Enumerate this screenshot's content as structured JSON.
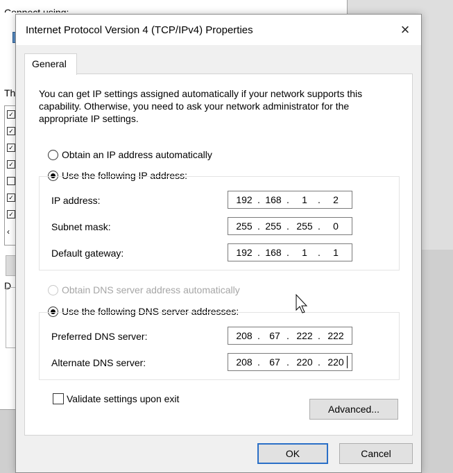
{
  "background": {
    "connect_using_partial": "Connect using:",
    "this_connection_partial": "Th",
    "d_partial": "D"
  },
  "dialog": {
    "title": "Internet Protocol Version 4 (TCP/IPv4) Properties",
    "close_icon": "×",
    "tab_general": "General",
    "description": "You can get IP settings assigned automatically if your network supports this capability. Otherwise, you need to ask your network administrator for the appropriate IP settings.",
    "ip_auto_label": "Obtain an IP address automatically",
    "ip_manual_label": "Use the following IP address:",
    "ip_address_label": "IP address:",
    "ip_address": [
      "192",
      "168",
      "1",
      "2"
    ],
    "subnet_mask_label": "Subnet mask:",
    "subnet_mask": [
      "255",
      "255",
      "255",
      "0"
    ],
    "default_gateway_label": "Default gateway:",
    "default_gateway": [
      "192",
      "168",
      "1",
      "1"
    ],
    "dns_auto_label": "Obtain DNS server address automatically",
    "dns_manual_label": "Use the following DNS server addresses:",
    "preferred_dns_label": "Preferred DNS server:",
    "preferred_dns": [
      "208",
      "67",
      "222",
      "222"
    ],
    "alternate_dns_label": "Alternate DNS server:",
    "alternate_dns": [
      "208",
      "67",
      "220",
      "220"
    ],
    "validate_label": "Validate settings upon exit",
    "advanced_button": "Advanced...",
    "ok_button": "OK",
    "cancel_button": "Cancel",
    "selected_ip_mode": "manual",
    "selected_dns_mode": "manual",
    "validate_checked": false
  },
  "colors": {
    "dialog_bg": "#f0f0f0",
    "panel_bg": "#ffffff",
    "default_button_border": "#2a6fc7"
  }
}
